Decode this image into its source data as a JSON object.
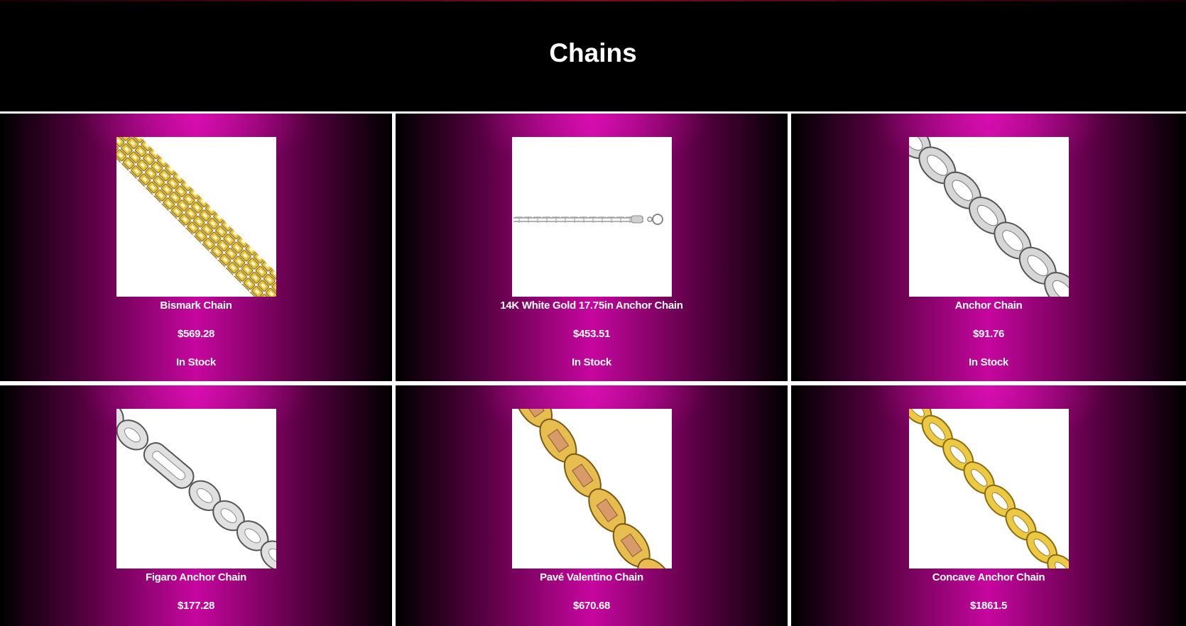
{
  "page": {
    "title": "Chains"
  },
  "products": [
    {
      "name": "Bismark Chain",
      "price": "$569.28",
      "stock": "In Stock",
      "image_icon": "bismark-chain-image",
      "metal_color": "#e8c43a"
    },
    {
      "name": "14K White Gold 17.75in Anchor Chain",
      "price": "$453.51",
      "stock": "In Stock",
      "image_icon": "anchor-chain-white-gold-image",
      "metal_color": "#bdbdbd"
    },
    {
      "name": "Anchor Chain",
      "price": "$91.76",
      "stock": "In Stock",
      "image_icon": "anchor-chain-silver-image",
      "metal_color": "#c8c8c8"
    },
    {
      "name": "Figaro Anchor Chain",
      "price": "$177.28",
      "stock": "",
      "image_icon": "figaro-anchor-chain-image",
      "metal_color": "#c8c8c8"
    },
    {
      "name": "Pavé Valentino Chain",
      "price": "$670.68",
      "stock": "",
      "image_icon": "pave-valentino-chain-image",
      "metal_color": "#e2b24a"
    },
    {
      "name": "Concave Anchor Chain",
      "price": "$1861.5",
      "stock": "",
      "image_icon": "concave-anchor-chain-image",
      "metal_color": "#e6c53a"
    }
  ],
  "colors": {
    "header_bg": "#000000",
    "card_gradient_center": "#c6069f",
    "card_gradient_edge": "#000000",
    "text": "#ffffff"
  }
}
